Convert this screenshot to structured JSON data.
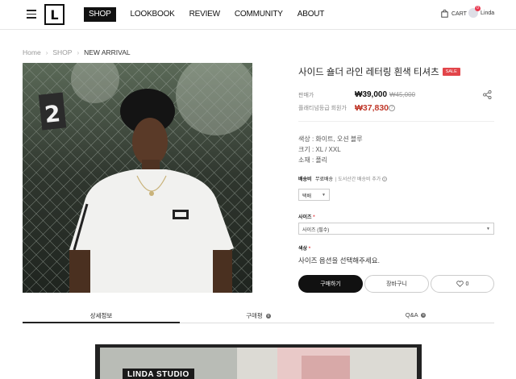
{
  "header": {
    "logo": "L",
    "nav": [
      "SHOP",
      "LOOKBOOK",
      "REVIEW",
      "COMMUNITY",
      "ABOUT"
    ],
    "cart_label": "CART",
    "user_name": "Linda",
    "user_badge": "0"
  },
  "breadcrumb": {
    "items": [
      "Home",
      "SHOP",
      "NEW ARRIVAL"
    ]
  },
  "photo": {
    "number": "2"
  },
  "product": {
    "title": "사이드 숄더 라인 레터링 흰색 티셔츠",
    "sale_badge": "SALE",
    "price_label": "판매가",
    "price": "₩39,000",
    "old_price": "₩45,000",
    "member_label": "플래티넘등급 회원가",
    "member_price": "₩37,830",
    "specs": [
      "색상 : 화이트, 오션 블루",
      "크기 : XL / XXL",
      "소재 : 폴리"
    ],
    "shipping_label": "배송비",
    "shipping_value": "무료배송",
    "shipping_extra": "| 도서산간 배송비 추가",
    "shipping_select": "택배",
    "size_label": "사이즈",
    "size_select": "사이즈 (필수)",
    "color_label": "색상",
    "choose_message": "사이즈 옵션을 선택해주세요.",
    "buy_button": "구매하기",
    "cart_button": "장바구니",
    "like_count": "0"
  },
  "tabs": [
    {
      "label": "상세정보",
      "count": ""
    },
    {
      "label": "구매평",
      "count": "0"
    },
    {
      "label": "Q&A",
      "count": "0"
    }
  ],
  "banner": {
    "text": "LINDA STUDIO"
  },
  "colors": {
    "accent": "#111111",
    "sale": "#e2454a",
    "member_price": "#c0392b"
  }
}
